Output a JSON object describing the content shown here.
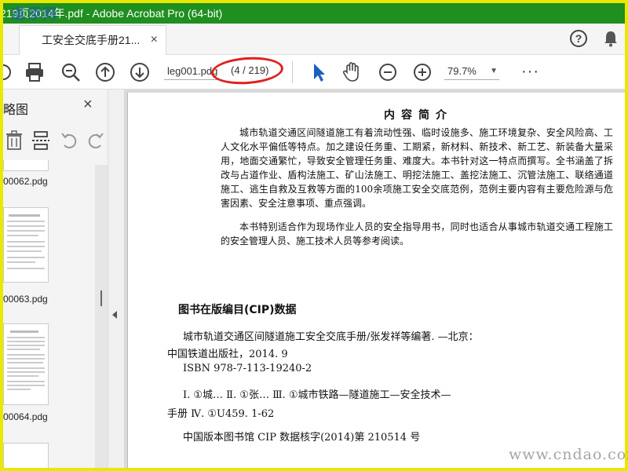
{
  "window": {
    "title": "219页2014年.pdf - Adobe Acrobat Pro (64-bit)",
    "watermark_top": "道添网"
  },
  "tab": {
    "label": "工安全交底手册21...",
    "close": "×"
  },
  "toolbar": {
    "page_field": "leg001.pdg",
    "page_count": "(4 / 219)",
    "zoom": "79.7%",
    "more": "···"
  },
  "sidebar": {
    "title": "略图",
    "close": "×",
    "thumbnails": [
      {
        "label": "00062.pdg"
      },
      {
        "label": "00063.pdg"
      },
      {
        "label": "00064.pdg"
      }
    ]
  },
  "document": {
    "intro_heading": "内容简介",
    "intro_p1": "城市轨道交通区间隧道施工有着流动性强、临时设施多、施工环境复杂、安全风险高、工人文化水平偏低等特点。加之建设任务重、工期紧，新材料、新技术、新工艺、新装备大量采用，地面交通繁忙，导致安全管理任务重、难度大。本书针对这一特点而撰写。全书涵盖了拆改与占道作业、盾构法施工、矿山法施工、明挖法施工、盖挖法施工、沉管法施工、联络通道施工、逃生自救及互救等方面的100余项施工安全交底范例，范例主要内容有主要危险源与危害因素、安全注意事项、重点强调。",
    "intro_p2": "本书特别适合作为现场作业人员的安全指导用书，同时也适合从事城市轨道交通工程施工的安全管理人员、施工技术人员等参考阅读。",
    "cip_heading": "图书在版编目(CIP)数据",
    "cip_line1": "城市轨道交通区间隧道施工安全交底手册/张发祥等编著. —北京：",
    "cip_line2": "中国铁道出版社，2014. 9",
    "cip_line3": "ISBN 978-7-113-19240-2",
    "cip_line4": "Ⅰ. ①城…   Ⅱ. ①张…   Ⅲ. ①城市铁路—隧道施工—安全技术—",
    "cip_line5": "手册   Ⅳ. ①U459. 1-62",
    "cip_line6": "中国版本图书馆 CIP 数据核字(2014)第 210514 号"
  },
  "watermark_bottom": "www.cndao.com",
  "colors": {
    "outer_border": "#e8e800",
    "title_bar": "#1f8f1f",
    "highlight_ellipse": "#e02020",
    "select_tool": "#1b5fc1"
  }
}
